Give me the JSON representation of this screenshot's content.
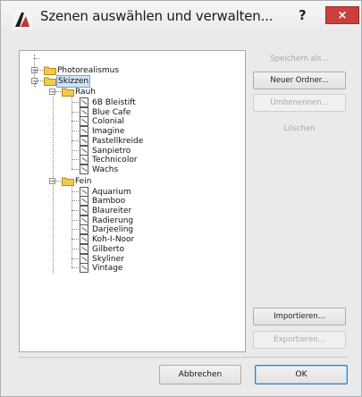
{
  "window": {
    "title": "Szenen auswählen und verwalten...",
    "help_label": "?",
    "close_label": "×"
  },
  "tree": {
    "root_items": [
      {
        "label": "Photorealismus",
        "expanded": false
      },
      {
        "label": "Skizzen",
        "expanded": true,
        "selected": true
      }
    ],
    "groups": [
      {
        "label": "Rauh",
        "items": [
          "6B Bleistift",
          "Blue Cafe",
          "Colonial",
          "Imagine",
          "Pastellkreide",
          "Sanpietro",
          "Technicolor",
          "Wachs"
        ]
      },
      {
        "label": "Fein",
        "items": [
          "Aquarium",
          "Bamboo",
          "Blaureiter",
          "Radierung",
          "Darjeeling",
          "Koh-I-Noor",
          "Gilberto",
          "Skyliner",
          "Vintage"
        ]
      }
    ]
  },
  "buttons": {
    "save_as": "Speichern als...",
    "new_folder": "Neuer Ordner...",
    "rename": "Umbenennen...",
    "delete": "Löschen",
    "import": "Importieren...",
    "export": "Exportieren..."
  },
  "footer": {
    "cancel": "Abbrechen",
    "ok": "OK"
  },
  "colors": {
    "close_bg": "#c8413a",
    "selection": "#cde3f8",
    "folder": "#f2c94c"
  }
}
